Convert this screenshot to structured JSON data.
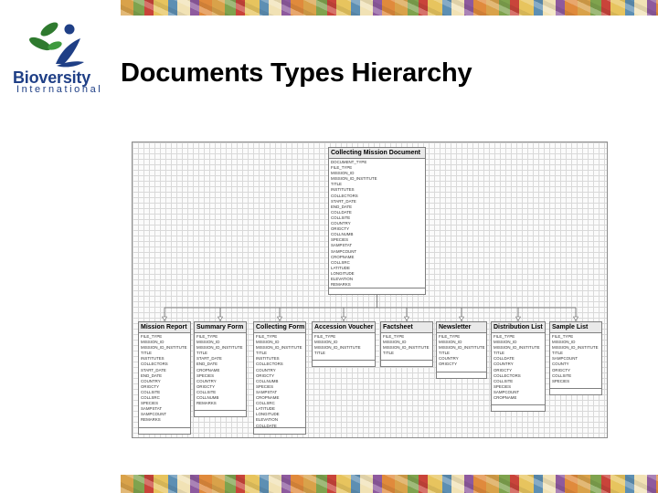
{
  "slide": {
    "title": "Documents Types Hierarchy",
    "logo_text": "Bioversity",
    "logo_subtext": "International"
  },
  "colors": {
    "logo_blue": "#1f3f86",
    "logo_green": "#2f7a2f",
    "grid": "#d9d9d9"
  },
  "diagram": {
    "root": {
      "name": "Collecting Mission Document",
      "fields": [
        "DOCUMENT_TYPE",
        "FILE_TYPE",
        "MISSION_ID",
        "MISSION_ID_INSTITUTE",
        "TITLE",
        "INSTITUTES",
        "COLLECTORS",
        "START_DATE",
        "END_DATE",
        "COLLDATE",
        "COLLSITE",
        "COUNTRY",
        "ORIGCTY",
        "COLLNUMB",
        "SPECIES",
        "SAMPSTAT",
        "SAMPCOUNT",
        "CROPNAME",
        "COLLSRC",
        "LATITUDE",
        "LONGITUDE",
        "ELEVATION",
        "REMARKS"
      ]
    },
    "children": [
      {
        "name": "Mission Report",
        "fields": [
          "FILE_TYPE",
          "MISSION_ID",
          "MISSION_ID_INSTITUTE",
          "TITLE",
          "INSTITUTES",
          "COLLECTORS",
          "START_DATE",
          "END_DATE",
          "COUNTRY",
          "ORIGCTY",
          "COLLSITE",
          "COLLSRC",
          "SPECIES",
          "SAMPSTAT",
          "SAMPCOUNT",
          "REMARKS"
        ]
      },
      {
        "name": "Summary Form",
        "fields": [
          "FILE_TYPE",
          "MISSION_ID",
          "MISSION_ID_INSTITUTE",
          "TITLE",
          "START_DATE",
          "END_DATE",
          "CROPNAME",
          "SPECIES",
          "COUNTRY",
          "ORIGCTY",
          "COLLSITE",
          "COLLNUMB",
          "REMARKS"
        ]
      },
      {
        "name": "Collecting Form",
        "fields": [
          "FILE_TYPE",
          "MISSION_ID",
          "MISSION_ID_INSTITUTE",
          "TITLE",
          "INSTITUTES",
          "COLLECTORS",
          "COUNTRY",
          "ORIGCTY",
          "COLLNUMB",
          "SPECIES",
          "SAMPSTAT",
          "CROPNAME",
          "COLLSRC",
          "LATITUDE",
          "LONGITUDE",
          "ELEVATION",
          "COLLDATE"
        ]
      },
      {
        "name": "Accession Voucher",
        "fields": [
          "FILE_TYPE",
          "MISSION_ID",
          "MISSION_ID_INSTITUTE",
          "TITLE"
        ]
      },
      {
        "name": "Factsheet",
        "fields": [
          "FILE_TYPE",
          "MISSION_ID",
          "MISSION_ID_INSTITUTE",
          "TITLE"
        ]
      },
      {
        "name": "Newsletter",
        "fields": [
          "FILE_TYPE",
          "MISSION_ID",
          "MISSION_ID_INSTITUTE",
          "TITLE",
          "COUNTRY",
          "ORIGCTY"
        ]
      },
      {
        "name": "Distribution List",
        "fields": [
          "FILE_TYPE",
          "MISSION_ID",
          "MISSION_ID_INSTITUTE",
          "TITLE",
          "COLLDATE",
          "COUNTRY",
          "ORIGCTY",
          "COLLECTORS",
          "COLLSITE",
          "SPECIES",
          "SAMPCOUNT",
          "CROPNAME"
        ]
      },
      {
        "name": "Sample List",
        "fields": [
          "FILE_TYPE",
          "MISSION_ID",
          "MISSION_ID_INSTITUTE",
          "TITLE",
          "SAMPCOUNT",
          "COUNTY",
          "ORIGCTY",
          "COLLSITE",
          "SPECIES"
        ]
      }
    ]
  }
}
